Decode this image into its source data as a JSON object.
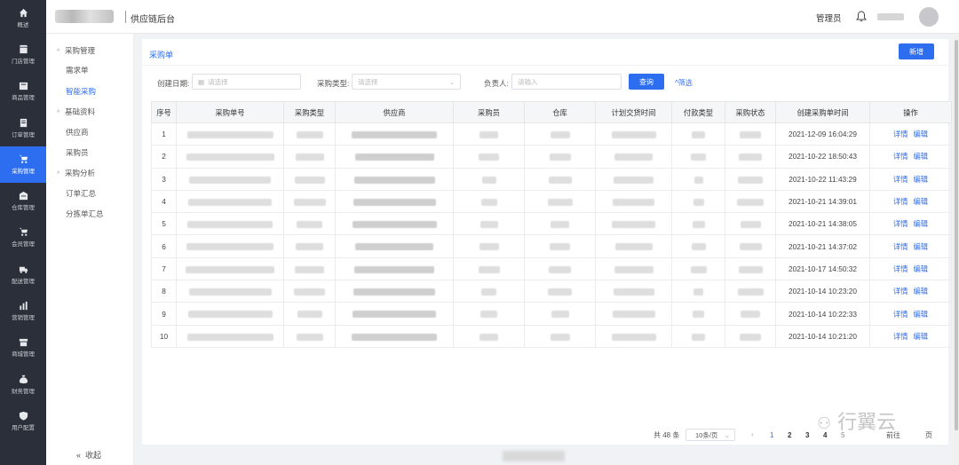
{
  "header": {
    "brand": "供应链后台",
    "admin": "管理员"
  },
  "nav": [
    {
      "label": "概述",
      "icon": "home-icon"
    },
    {
      "label": "门店管理",
      "icon": "store-icon"
    },
    {
      "label": "商品管理",
      "icon": "box-icon"
    },
    {
      "label": "订单管理",
      "icon": "order-icon"
    },
    {
      "label": "采购管理",
      "icon": "cart-icon",
      "active": true
    },
    {
      "label": "仓库管理",
      "icon": "warehouse-icon"
    },
    {
      "label": "会员管理",
      "icon": "member-icon"
    },
    {
      "label": "配送管理",
      "icon": "truck-icon"
    },
    {
      "label": "营销管理",
      "icon": "chart-icon"
    },
    {
      "label": "商城管理",
      "icon": "shop-icon"
    },
    {
      "label": "财务管理",
      "icon": "money-bag-icon"
    },
    {
      "label": "用户配置",
      "icon": "shield-icon"
    }
  ],
  "submenu": {
    "groups": [
      {
        "label": "采购管理",
        "items": [
          "需求单",
          "智能采购"
        ]
      },
      {
        "label": "基础资料",
        "items": [
          "供应商",
          "采购员"
        ]
      },
      {
        "label": "采购分析",
        "items": [
          "订单汇总",
          "分拣单汇总"
        ]
      }
    ],
    "active_item": "智能采购",
    "collapse_label": "收起"
  },
  "card": {
    "title": "采购单",
    "new_button": "新增"
  },
  "filters": {
    "date_label": "创建日期:",
    "date_placeholder": "请选择",
    "type_label": "采购类型:",
    "type_placeholder": "请选择",
    "owner_label": "负责人:",
    "owner_placeholder": "请输入",
    "query_button": "查询",
    "filter_link": "^筛选"
  },
  "table": {
    "columns": [
      "序号",
      "采购单号",
      "采购类型",
      "供应商",
      "采购员",
      "仓库",
      "计划交货时间",
      "付款类型",
      "采购状态",
      "创建采购单时间",
      "操作"
    ],
    "rows": [
      {
        "no": "1",
        "created": "2021-12-09 16:04:29"
      },
      {
        "no": "2",
        "created": "2021-10-22 18:50:43"
      },
      {
        "no": "3",
        "created": "2021-10-22 11:43:29"
      },
      {
        "no": "4",
        "created": "2021-10-21 14:39:01"
      },
      {
        "no": "5",
        "created": "2021-10-21 14:38:05"
      },
      {
        "no": "6",
        "created": "2021-10-21 14:37:02"
      },
      {
        "no": "7",
        "created": "2021-10-17 14:50:32"
      },
      {
        "no": "8",
        "created": "2021-10-14 10:23:20"
      },
      {
        "no": "9",
        "created": "2021-10-14 10:22:33"
      },
      {
        "no": "10",
        "created": "2021-10-14 10:21:20"
      }
    ],
    "detail_label": "详情",
    "edit_label": "编辑"
  },
  "pagination": {
    "total": "共 48 条",
    "page_size": "10条/页",
    "prev": "‹",
    "pages": [
      "1",
      "2",
      "3",
      "4",
      "5"
    ],
    "goto": "前往",
    "page_suffix": "页"
  },
  "watermark": "行翼云"
}
